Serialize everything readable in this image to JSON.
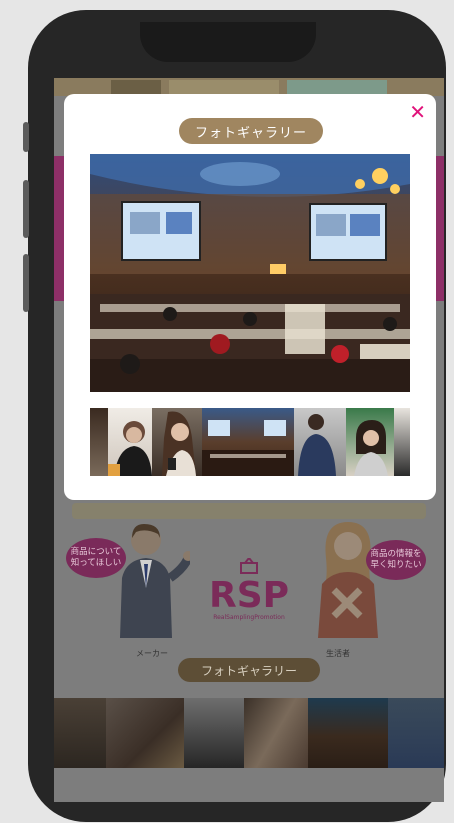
{
  "background_page": {
    "top_banner_text": "",
    "bubble_left": "商品について\n知ってほしい",
    "bubble_right": "商品の情報を\n早く知りたい",
    "rsp_logo": "RSP",
    "rsp_subtitle": "RealSamplingPromotion",
    "maker_label": "メーカー",
    "consumer_label": "生活者",
    "gallery_heading": "フォトギャラリー"
  },
  "modal": {
    "title": "フォトギャラリー",
    "close_icon": "close-icon",
    "main_photo": "conference-hall-photo",
    "thumbnails": [
      {
        "name": "thumb-partial-left"
      },
      {
        "name": "thumb-woman-talking"
      },
      {
        "name": "thumb-woman-smartphone"
      },
      {
        "name": "thumb-conference-hall"
      },
      {
        "name": "thumb-man-in-suit"
      },
      {
        "name": "thumb-woman-smiling"
      },
      {
        "name": "thumb-partial-right"
      }
    ]
  },
  "colors": {
    "accent_pink": "#e0127a",
    "title_pill": "#a08660",
    "phone_frame": "#262626",
    "overlay_gray": "#7e7e7e"
  }
}
